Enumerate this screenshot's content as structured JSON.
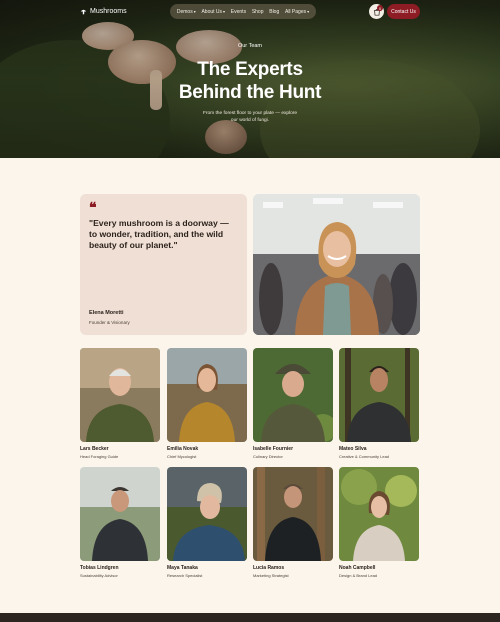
{
  "nav": {
    "logo": "Mushrooms",
    "items": [
      {
        "label": "Demos",
        "chevron": true
      },
      {
        "label": "About Us",
        "chevron": true
      },
      {
        "label": "Events",
        "chevron": false
      },
      {
        "label": "Shop",
        "chevron": false
      },
      {
        "label": "Blog",
        "chevron": false
      },
      {
        "label": "All Pages",
        "chevron": true
      }
    ],
    "cart_count": "0",
    "contact_label": "Contact Us"
  },
  "hero": {
    "eyebrow": "Our Team",
    "title_line1": "The Experts",
    "title_line2": "Behind the Hunt",
    "subtitle": "From the forest floor to your plate — explore our world of fungi."
  },
  "quote": {
    "text": "\"Every mushroom is a doorway — to wonder, tradition, and the wild beauty of our planet.\"",
    "name": "Elena Moretti",
    "role": "Founder & Visionary"
  },
  "team": [
    {
      "name": "Lars Becker",
      "role": "Head Foraging Guide"
    },
    {
      "name": "Emilia Novak",
      "role": "Chief Mycologist"
    },
    {
      "name": "Isabelle Fournier",
      "role": "Culinary Director"
    },
    {
      "name": "Mateo Silva",
      "role": "Creative & Community Lead"
    },
    {
      "name": "Tobias Lindgren",
      "role": "Sustainability Advisor"
    },
    {
      "name": "Maya Tanaka",
      "role": "Research Specialist"
    },
    {
      "name": "Lucia Ramos",
      "role": "Marketing Strategist"
    },
    {
      "name": "Noah Campbell",
      "role": "Design & Brand Lead"
    }
  ],
  "colors": {
    "accent": "#8e1c24",
    "background": "#fbf5ec",
    "quote_card": "#efdfd4"
  }
}
